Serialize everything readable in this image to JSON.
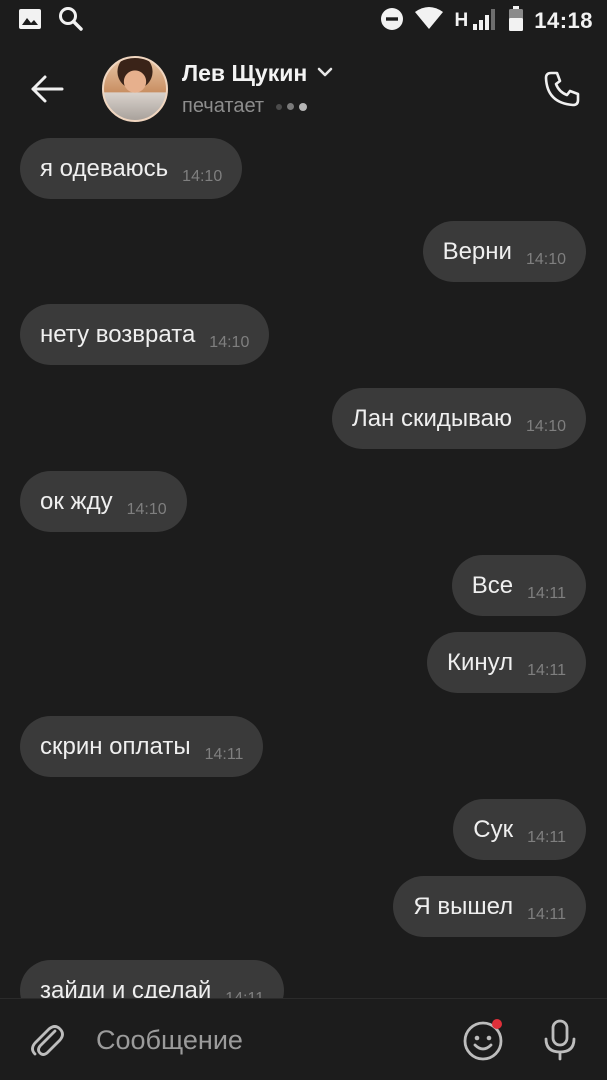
{
  "status_bar": {
    "time": "14:18",
    "network": "H",
    "icons": [
      "gallery-icon",
      "search-icon",
      "do-not-disturb-icon",
      "wifi-icon",
      "signal-icon",
      "battery-icon"
    ]
  },
  "header": {
    "contact_name": "Лев Щукин",
    "status": "печатает",
    "icons": [
      "back-arrow-icon",
      "chevron-down-icon",
      "phone-icon"
    ]
  },
  "messages": [
    {
      "direction": "in",
      "text": "я одеваюсь",
      "time": "14:10"
    },
    {
      "direction": "out",
      "text": "Верни",
      "time": "14:10"
    },
    {
      "direction": "in",
      "text": "нету возврата",
      "time": "14:10"
    },
    {
      "direction": "out",
      "text": "Лан скидываю",
      "time": "14:10"
    },
    {
      "direction": "in",
      "text": "ок жду",
      "time": "14:10"
    },
    {
      "direction": "out",
      "text": "Все",
      "time": "14:11"
    },
    {
      "direction": "out",
      "text": "Кинул",
      "time": "14:11"
    },
    {
      "direction": "in",
      "text": "скрин оплаты",
      "time": "14:11"
    },
    {
      "direction": "out",
      "text": "Сук",
      "time": "14:11"
    },
    {
      "direction": "out",
      "text": "Я вышел",
      "time": "14:11"
    },
    {
      "direction": "in",
      "text": "зайди и сделай",
      "time": "14:11"
    }
  ],
  "composer": {
    "placeholder": "Сообщение",
    "icons": [
      "attach-icon",
      "emoji-icon",
      "microphone-icon"
    ]
  },
  "colors": {
    "background": "#1c1c1c",
    "bubble": "#3a3a3a",
    "text": "#efefef",
    "muted": "#7f7f7f",
    "notification_dot": "#e0303a"
  }
}
